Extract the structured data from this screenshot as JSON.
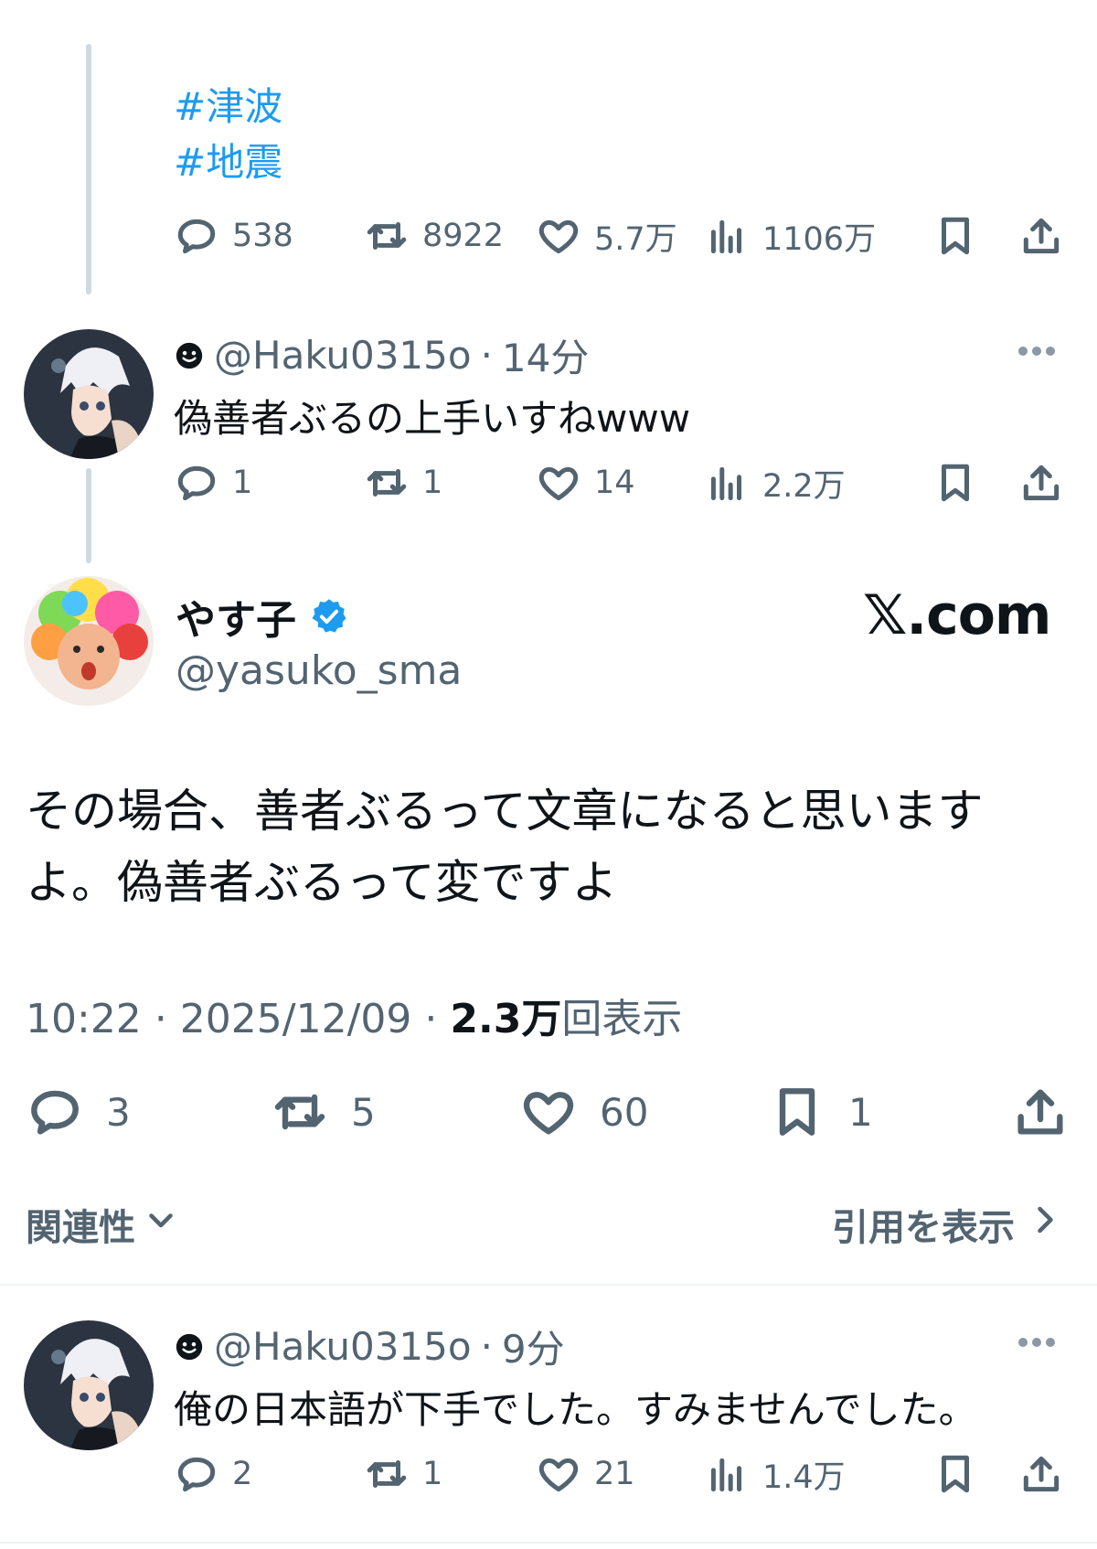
{
  "colors": {
    "link": "#1d9bf0",
    "verified": "#1d9bf0",
    "muted": "#536471",
    "text": "#0f1419"
  },
  "parent_tweet": {
    "hashtags": [
      "#津波",
      "#地震"
    ],
    "stats": {
      "replies": "538",
      "reposts": "8922",
      "likes": "5.7万",
      "views": "1106万"
    }
  },
  "reply_1": {
    "handle": "@Haku0315o",
    "time": "14分",
    "text": "偽善者ぶるの上手いすねwww",
    "stats": {
      "replies": "1",
      "reposts": "1",
      "likes": "14",
      "views": "2.2万"
    }
  },
  "main_tweet": {
    "display_name": "やす子",
    "handle": "@yasuko_sma",
    "watermark": "𝕏.com",
    "text_lines": [
      "その場合、善者ぶるって文章になると思います",
      "よ。偽善者ぶるって変ですよ"
    ],
    "time": "10:22",
    "date": "2025/12/09",
    "views_count": "2.3万",
    "views_label": "回表示",
    "stats": {
      "replies": "3",
      "reposts": "5",
      "likes": "60",
      "bookmarks": "1"
    },
    "relevance_label": "関連性",
    "quotes_label": "引用を表示"
  },
  "reply_2": {
    "handle": "@Haku0315o",
    "time": "9分",
    "text": "俺の日本語が下手でした。すみませんでした。",
    "stats": {
      "replies": "2",
      "reposts": "1",
      "likes": "21",
      "views": "1.4万"
    }
  }
}
